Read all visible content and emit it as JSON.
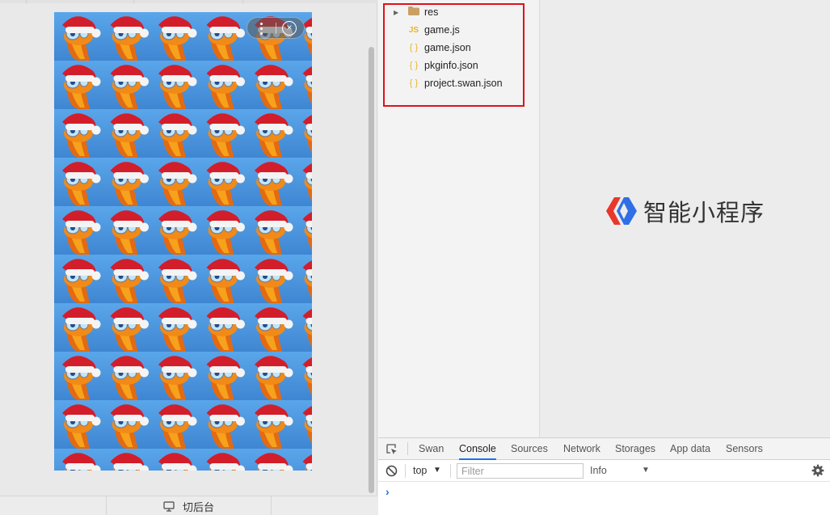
{
  "simulator": {
    "close_symbol": "×",
    "bottom_button_label": "切后台"
  },
  "file_tree": {
    "items": [
      {
        "name": "res",
        "type": "folder",
        "icon": "folder-icon"
      },
      {
        "name": "game.js",
        "type": "js",
        "icon_text": "JS"
      },
      {
        "name": "game.json",
        "type": "json",
        "icon_text": "{ }"
      },
      {
        "name": "pkginfo.json",
        "type": "json",
        "icon_text": "{ }"
      },
      {
        "name": "project.swan.json",
        "type": "json",
        "icon_text": "{ }"
      }
    ],
    "highlight_color": "#e0101c"
  },
  "brand": {
    "name": "智能小程序",
    "logo_colors": [
      "#e8372b",
      "#2f6fe6"
    ]
  },
  "devtools": {
    "tabs": [
      "Swan",
      "Console",
      "Sources",
      "Network",
      "Storages",
      "App data",
      "Sensors"
    ],
    "active_tab": "Console",
    "context": "top",
    "filter_placeholder": "Filter",
    "level": "Info",
    "prompt_symbol": "›"
  }
}
